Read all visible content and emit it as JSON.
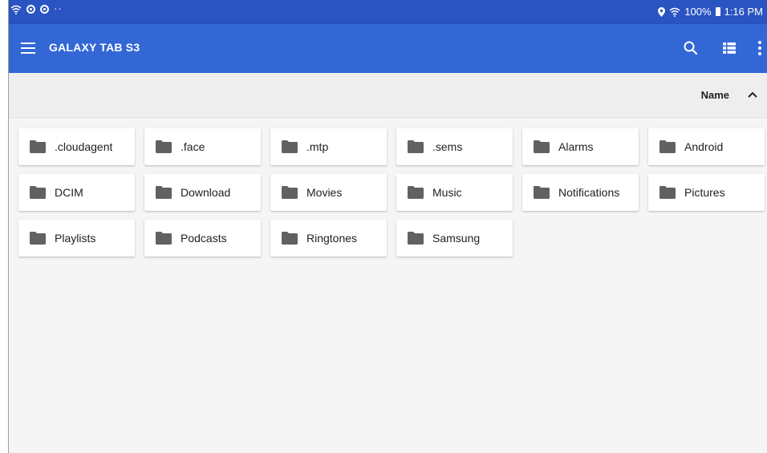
{
  "status_bar": {
    "time": "1:16 PM",
    "battery": "100%",
    "dots": "··",
    "icons": [
      "wifi-icon",
      "target-icon",
      "target-icon",
      "location-icon",
      "wifi-icon",
      "battery-icon"
    ]
  },
  "app_bar": {
    "title": "GALAXY TAB S3",
    "actions": [
      "search-icon",
      "list-view-icon",
      "more-vert-icon"
    ],
    "color": "#3367d6"
  },
  "sort": {
    "label": "Name",
    "direction": "ascending"
  },
  "folders": [
    {
      "name": ".cloudagent"
    },
    {
      "name": ".face"
    },
    {
      "name": ".mtp"
    },
    {
      "name": ".sems"
    },
    {
      "name": "Alarms"
    },
    {
      "name": "Android"
    },
    {
      "name": "DCIM"
    },
    {
      "name": "Download"
    },
    {
      "name": "Movies"
    },
    {
      "name": "Music"
    },
    {
      "name": "Notifications"
    },
    {
      "name": "Pictures"
    },
    {
      "name": "Playlists"
    },
    {
      "name": "Podcasts"
    },
    {
      "name": "Ringtones"
    },
    {
      "name": "Samsung"
    }
  ]
}
